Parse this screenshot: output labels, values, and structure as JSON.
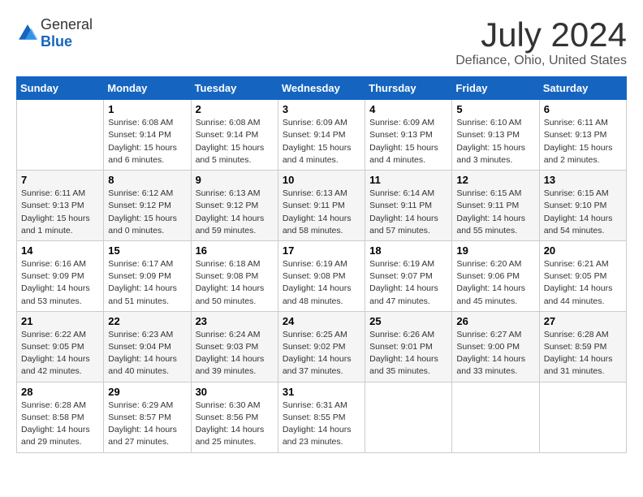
{
  "header": {
    "logo_general": "General",
    "logo_blue": "Blue",
    "month_year": "July 2024",
    "location": "Defiance, Ohio, United States"
  },
  "calendar": {
    "days_of_week": [
      "Sunday",
      "Monday",
      "Tuesday",
      "Wednesday",
      "Thursday",
      "Friday",
      "Saturday"
    ],
    "weeks": [
      [
        {
          "day": "",
          "sunrise": "",
          "sunset": "",
          "daylight": ""
        },
        {
          "day": "1",
          "sunrise": "Sunrise: 6:08 AM",
          "sunset": "Sunset: 9:14 PM",
          "daylight": "Daylight: 15 hours and 6 minutes."
        },
        {
          "day": "2",
          "sunrise": "Sunrise: 6:08 AM",
          "sunset": "Sunset: 9:14 PM",
          "daylight": "Daylight: 15 hours and 5 minutes."
        },
        {
          "day": "3",
          "sunrise": "Sunrise: 6:09 AM",
          "sunset": "Sunset: 9:14 PM",
          "daylight": "Daylight: 15 hours and 4 minutes."
        },
        {
          "day": "4",
          "sunrise": "Sunrise: 6:09 AM",
          "sunset": "Sunset: 9:13 PM",
          "daylight": "Daylight: 15 hours and 4 minutes."
        },
        {
          "day": "5",
          "sunrise": "Sunrise: 6:10 AM",
          "sunset": "Sunset: 9:13 PM",
          "daylight": "Daylight: 15 hours and 3 minutes."
        },
        {
          "day": "6",
          "sunrise": "Sunrise: 6:11 AM",
          "sunset": "Sunset: 9:13 PM",
          "daylight": "Daylight: 15 hours and 2 minutes."
        }
      ],
      [
        {
          "day": "7",
          "sunrise": "Sunrise: 6:11 AM",
          "sunset": "Sunset: 9:13 PM",
          "daylight": "Daylight: 15 hours and 1 minute."
        },
        {
          "day": "8",
          "sunrise": "Sunrise: 6:12 AM",
          "sunset": "Sunset: 9:12 PM",
          "daylight": "Daylight: 15 hours and 0 minutes."
        },
        {
          "day": "9",
          "sunrise": "Sunrise: 6:13 AM",
          "sunset": "Sunset: 9:12 PM",
          "daylight": "Daylight: 14 hours and 59 minutes."
        },
        {
          "day": "10",
          "sunrise": "Sunrise: 6:13 AM",
          "sunset": "Sunset: 9:11 PM",
          "daylight": "Daylight: 14 hours and 58 minutes."
        },
        {
          "day": "11",
          "sunrise": "Sunrise: 6:14 AM",
          "sunset": "Sunset: 9:11 PM",
          "daylight": "Daylight: 14 hours and 57 minutes."
        },
        {
          "day": "12",
          "sunrise": "Sunrise: 6:15 AM",
          "sunset": "Sunset: 9:11 PM",
          "daylight": "Daylight: 14 hours and 55 minutes."
        },
        {
          "day": "13",
          "sunrise": "Sunrise: 6:15 AM",
          "sunset": "Sunset: 9:10 PM",
          "daylight": "Daylight: 14 hours and 54 minutes."
        }
      ],
      [
        {
          "day": "14",
          "sunrise": "Sunrise: 6:16 AM",
          "sunset": "Sunset: 9:09 PM",
          "daylight": "Daylight: 14 hours and 53 minutes."
        },
        {
          "day": "15",
          "sunrise": "Sunrise: 6:17 AM",
          "sunset": "Sunset: 9:09 PM",
          "daylight": "Daylight: 14 hours and 51 minutes."
        },
        {
          "day": "16",
          "sunrise": "Sunrise: 6:18 AM",
          "sunset": "Sunset: 9:08 PM",
          "daylight": "Daylight: 14 hours and 50 minutes."
        },
        {
          "day": "17",
          "sunrise": "Sunrise: 6:19 AM",
          "sunset": "Sunset: 9:08 PM",
          "daylight": "Daylight: 14 hours and 48 minutes."
        },
        {
          "day": "18",
          "sunrise": "Sunrise: 6:19 AM",
          "sunset": "Sunset: 9:07 PM",
          "daylight": "Daylight: 14 hours and 47 minutes."
        },
        {
          "day": "19",
          "sunrise": "Sunrise: 6:20 AM",
          "sunset": "Sunset: 9:06 PM",
          "daylight": "Daylight: 14 hours and 45 minutes."
        },
        {
          "day": "20",
          "sunrise": "Sunrise: 6:21 AM",
          "sunset": "Sunset: 9:05 PM",
          "daylight": "Daylight: 14 hours and 44 minutes."
        }
      ],
      [
        {
          "day": "21",
          "sunrise": "Sunrise: 6:22 AM",
          "sunset": "Sunset: 9:05 PM",
          "daylight": "Daylight: 14 hours and 42 minutes."
        },
        {
          "day": "22",
          "sunrise": "Sunrise: 6:23 AM",
          "sunset": "Sunset: 9:04 PM",
          "daylight": "Daylight: 14 hours and 40 minutes."
        },
        {
          "day": "23",
          "sunrise": "Sunrise: 6:24 AM",
          "sunset": "Sunset: 9:03 PM",
          "daylight": "Daylight: 14 hours and 39 minutes."
        },
        {
          "day": "24",
          "sunrise": "Sunrise: 6:25 AM",
          "sunset": "Sunset: 9:02 PM",
          "daylight": "Daylight: 14 hours and 37 minutes."
        },
        {
          "day": "25",
          "sunrise": "Sunrise: 6:26 AM",
          "sunset": "Sunset: 9:01 PM",
          "daylight": "Daylight: 14 hours and 35 minutes."
        },
        {
          "day": "26",
          "sunrise": "Sunrise: 6:27 AM",
          "sunset": "Sunset: 9:00 PM",
          "daylight": "Daylight: 14 hours and 33 minutes."
        },
        {
          "day": "27",
          "sunrise": "Sunrise: 6:28 AM",
          "sunset": "Sunset: 8:59 PM",
          "daylight": "Daylight: 14 hours and 31 minutes."
        }
      ],
      [
        {
          "day": "28",
          "sunrise": "Sunrise: 6:28 AM",
          "sunset": "Sunset: 8:58 PM",
          "daylight": "Daylight: 14 hours and 29 minutes."
        },
        {
          "day": "29",
          "sunrise": "Sunrise: 6:29 AM",
          "sunset": "Sunset: 8:57 PM",
          "daylight": "Daylight: 14 hours and 27 minutes."
        },
        {
          "day": "30",
          "sunrise": "Sunrise: 6:30 AM",
          "sunset": "Sunset: 8:56 PM",
          "daylight": "Daylight: 14 hours and 25 minutes."
        },
        {
          "day": "31",
          "sunrise": "Sunrise: 6:31 AM",
          "sunset": "Sunset: 8:55 PM",
          "daylight": "Daylight: 14 hours and 23 minutes."
        },
        {
          "day": "",
          "sunrise": "",
          "sunset": "",
          "daylight": ""
        },
        {
          "day": "",
          "sunrise": "",
          "sunset": "",
          "daylight": ""
        },
        {
          "day": "",
          "sunrise": "",
          "sunset": "",
          "daylight": ""
        }
      ]
    ]
  }
}
